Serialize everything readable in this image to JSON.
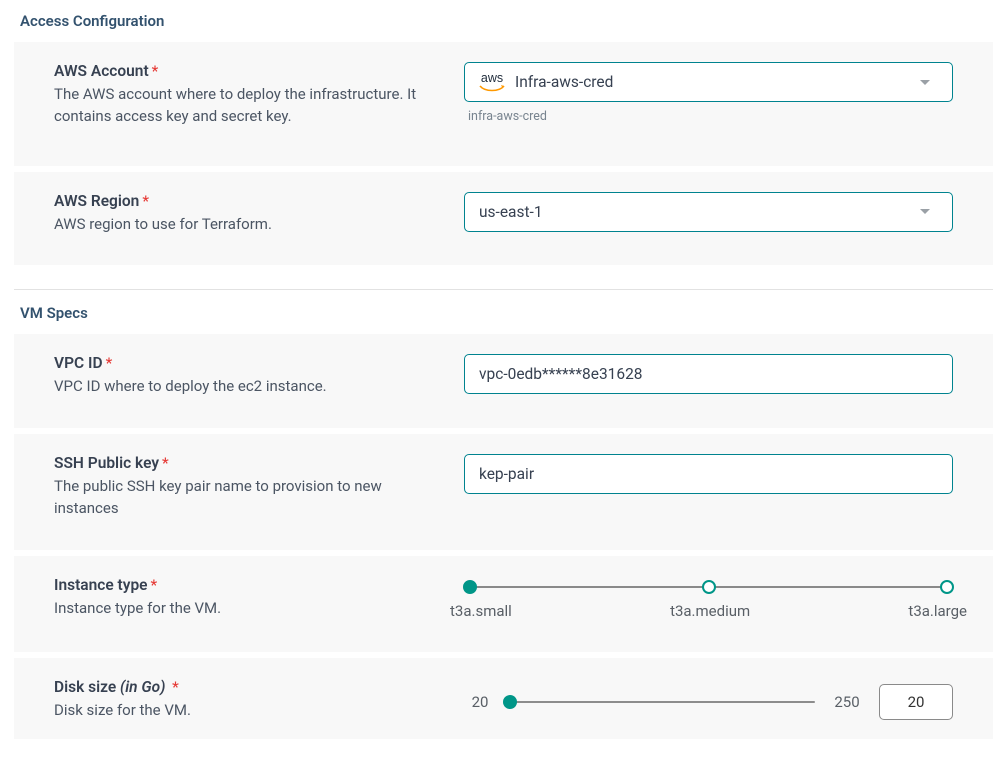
{
  "colors": {
    "accent": "#009688",
    "inputBorder": "#00838f",
    "required": "#e53935"
  },
  "sections": {
    "access": {
      "title": "Access Configuration",
      "awsAccount": {
        "label": "AWS Account",
        "required": "*",
        "description": "The AWS account where to deploy the infrastructure. It contains access key and secret key.",
        "badge": "aws",
        "value": "Infra-aws-cred",
        "hint": "infra-aws-cred"
      },
      "awsRegion": {
        "label": "AWS Region",
        "required": "*",
        "description": "AWS region to use for Terraform.",
        "value": "us-east-1"
      }
    },
    "vm": {
      "title": "VM Specs",
      "vpc": {
        "label": "VPC ID",
        "required": "*",
        "description": "VPC ID where to deploy the ec2 instance.",
        "value": "vpc-0edb******8e31628"
      },
      "ssh": {
        "label": "SSH Public key",
        "required": "*",
        "description": "The public SSH key pair name to provision to new instances",
        "value": "kep-pair"
      },
      "instanceType": {
        "label": "Instance type",
        "required": "*",
        "description": "Instance type for the VM.",
        "options": [
          "t3a.small",
          "t3a.medium",
          "t3a.large"
        ],
        "selectedIndex": 0
      },
      "disk": {
        "label": "Disk size ",
        "labelSuffix": "(in Go)",
        "required": "*",
        "description": "Disk size for the VM.",
        "min": 20,
        "max": 250,
        "value": 20
      }
    }
  }
}
